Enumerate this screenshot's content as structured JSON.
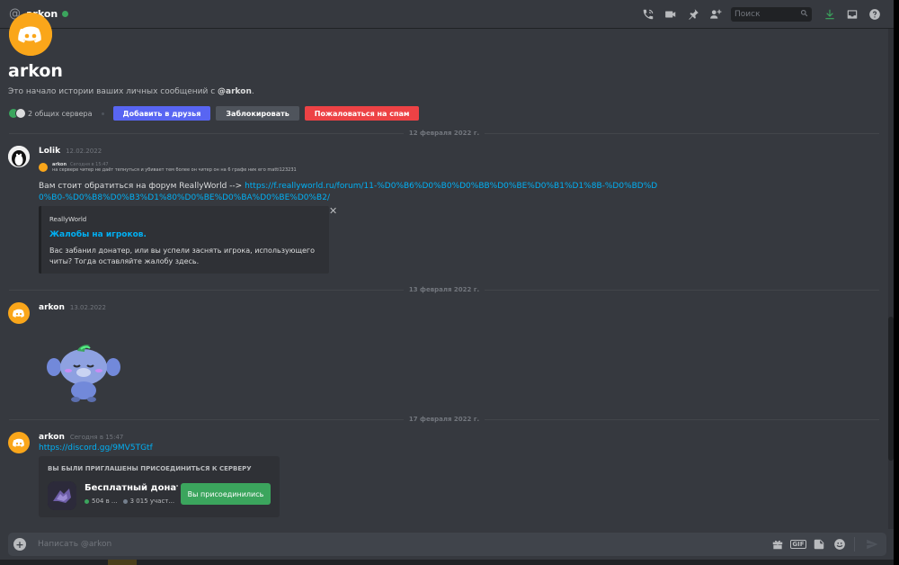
{
  "header": {
    "at_symbol": "@",
    "username": "arkon",
    "search_placeholder": "Поиск"
  },
  "intro": {
    "title": "arkon",
    "desc_prefix": "Это начало истории ваших личных сообщений с ",
    "desc_user": "@arkon",
    "desc_suffix": ".",
    "mutual_servers": "2 общих сервера",
    "add_friend": "Добавить в друзья",
    "block": "Заблокировать",
    "report_spam": "Пожаловаться на спам"
  },
  "dividers": [
    "12 февраля 2022 г.",
    "13 февраля 2022 г.",
    "17 февраля 2022 г."
  ],
  "messages": {
    "m1": {
      "author": "Lolik",
      "timestamp": "12.02.2022",
      "reply_author": "arkon",
      "reply_time": "Сегодня в 15:47",
      "reply_text": "на сервере читер не даёт тепнуться и убивает тем более он читер он на 6 графе ник его matti123231",
      "text_prefix": "Вам стоит обратиться на форум ReallyWorld --> ",
      "link": "https://f.reallyworld.ru/forum/11-%D0%B6%D0%B0%D0%BB%D0%BE%D0%B1%D1%8B-%D0%BD%D0%B0-%D0%B8%D0%B3%D1%80%D0%BE%D0%BA%D0%BE%D0%B2/",
      "embed": {
        "provider": "ReallyWorld",
        "title": "Жалобы на игроков.",
        "description": "Вас забанил донатер, или вы успели заснять игрока, использующего читы? Тогда оставляйте жалобу здесь."
      }
    },
    "m2": {
      "author": "arkon",
      "timestamp": "13.02.2022"
    },
    "m3": {
      "author": "arkon",
      "timestamp": "Сегодня в 15:47",
      "link": "https://discord.gg/9MV5TGtf",
      "invite": {
        "heading": "ВЫ БЫЛИ ПРИГЛАШЕНЫ ПРИСОЕДИНИТЬСЯ К СЕРВЕРУ",
        "server_name": "Бесплатный донат R",
        "online": "504 в ...",
        "members": "3 015 участ...",
        "joined_label": "Вы присоединились"
      }
    }
  },
  "composer": {
    "placeholder": "Написать @arkon",
    "gif": "GIF"
  },
  "colors": {
    "background": "#36393f",
    "accent_blue": "#5865f2",
    "danger_red": "#ed4245",
    "success_green": "#3ba55d",
    "link": "#00b0f4",
    "avatar_orange": "#faa61a"
  },
  "icons": [
    "at-icon",
    "call-icon",
    "video-icon",
    "pin-icon",
    "add-member-icon",
    "search-icon",
    "download-icon",
    "inbox-icon",
    "help-icon",
    "attach-icon",
    "gift-icon",
    "gif-icon",
    "sticker-icon",
    "emoji-icon",
    "send-icon",
    "close-icon"
  ]
}
